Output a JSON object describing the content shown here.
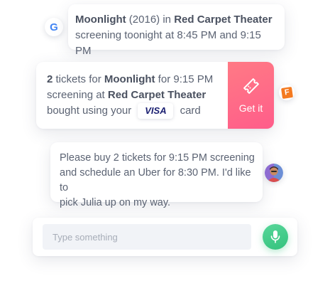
{
  "messages": {
    "google": {
      "avatar_icon": "google-logo-icon",
      "avatar_letter": "G",
      "movie": "Moonlight",
      "year": " (2016) in ",
      "theater": "Red Carpet Theater",
      "line2": "screening toonight at 8:45 PM and 9:15 PM"
    },
    "booking": {
      "count": "2",
      "t1": " tickets for ",
      "movie": "Moonlight",
      "t2": " for 9:15 PM",
      "t3": "screening at ",
      "theater": "Red Carpet Theater",
      "t4": "bought using your ",
      "card_brand": "VISA",
      "t5": " card",
      "action_label": "Get it",
      "action_icon": "ticket-icon",
      "source_icon": "fandango-logo-icon",
      "source_letter": "F",
      "action_color": "#ff6a88"
    },
    "user": {
      "line1": "Please buy 2 tickets for 9:15 PM screening",
      "line2": "and schedule an Uber for 8:30 PM. I'd like to",
      "line3": "pick Julia up on my way.",
      "avatar_icon": "user-avatar-icon"
    }
  },
  "composer": {
    "placeholder": "Type something",
    "value": "",
    "mic_icon": "microphone-icon",
    "mic_color": "#3cc985"
  }
}
